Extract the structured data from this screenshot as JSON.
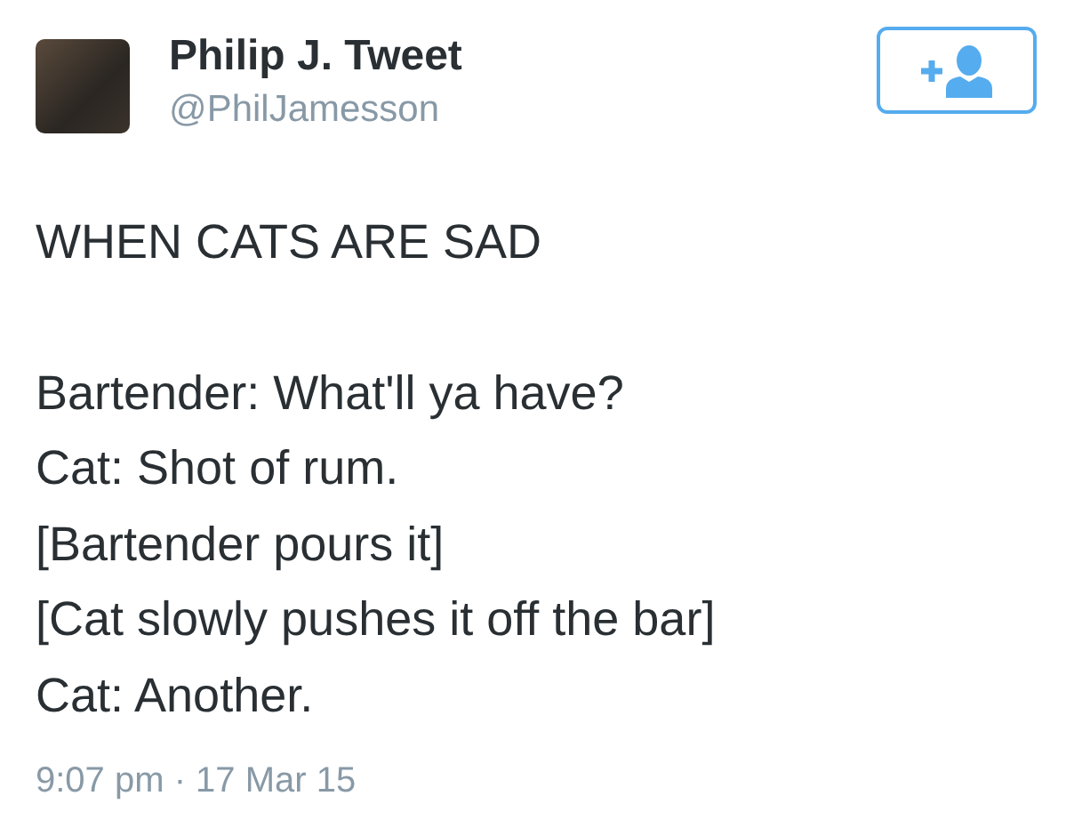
{
  "author": {
    "name": "Philip J. Tweet",
    "handle": "@PhilJamesson"
  },
  "follow_button": {
    "selected": false
  },
  "tweet": {
    "paragraphs": [
      [
        "WHEN CATS ARE SAD"
      ],
      [
        "Bartender: What'll ya have?",
        "Cat: Shot of rum.",
        "[Bartender pours it]",
        "[Cat slowly pushes it off the bar]",
        "Cat: Another."
      ]
    ]
  },
  "timestamp": "9:07 pm · 17 Mar 15"
}
